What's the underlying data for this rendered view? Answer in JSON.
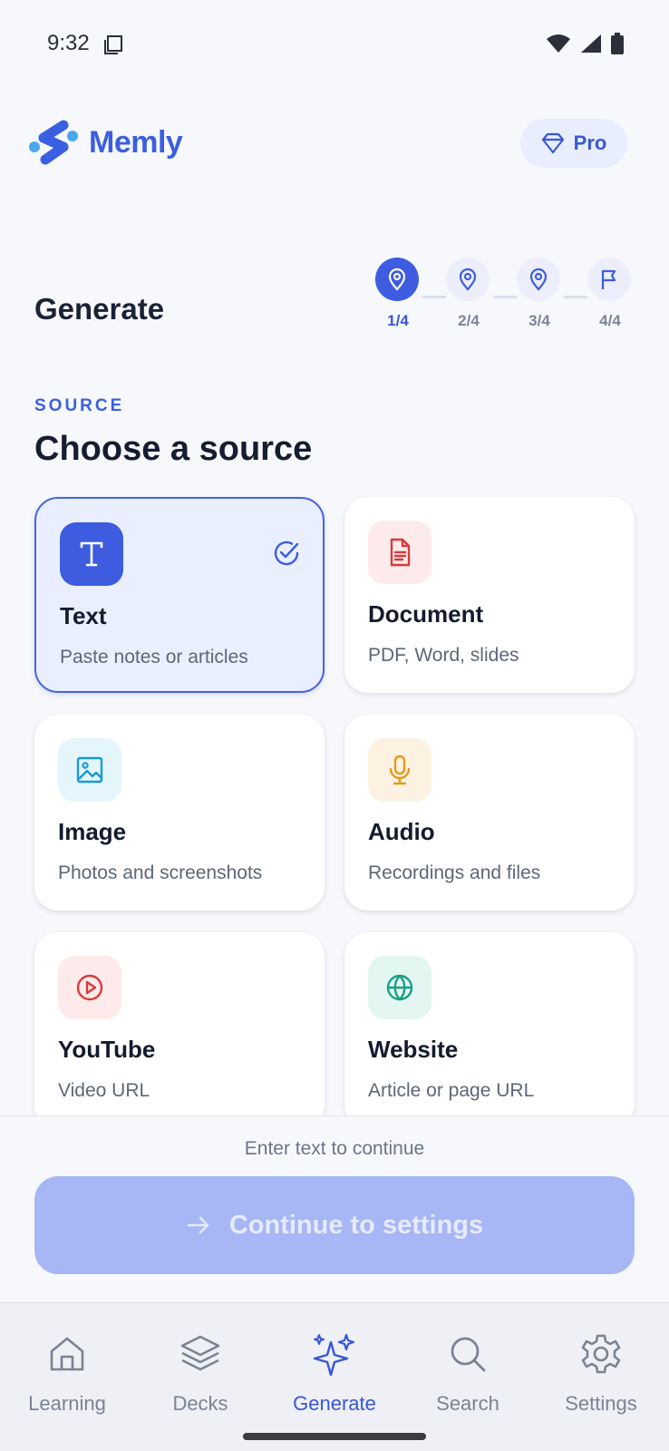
{
  "status_bar": {
    "time": "9:32"
  },
  "header": {
    "app_name": "Memly",
    "pro_label": "Pro"
  },
  "page": {
    "title": "Generate"
  },
  "stepper": {
    "steps": [
      {
        "label": "1/4",
        "icon": "location-pin-icon",
        "active": true
      },
      {
        "label": "2/4",
        "icon": "location-pin-icon",
        "active": false
      },
      {
        "label": "3/4",
        "icon": "location-pin-icon",
        "active": false
      },
      {
        "label": "4/4",
        "icon": "flag-icon",
        "active": false
      }
    ]
  },
  "section": {
    "eyebrow": "SOURCE",
    "title": "Choose a source"
  },
  "sources": [
    {
      "title": "Text",
      "subtitle": "Paste notes or articles",
      "icon": "text-t-icon",
      "selected": true
    },
    {
      "title": "Document",
      "subtitle": "PDF, Word, slides",
      "icon": "document-icon",
      "selected": false
    },
    {
      "title": "Image",
      "subtitle": "Photos and screenshots",
      "icon": "image-icon",
      "selected": false
    },
    {
      "title": "Audio",
      "subtitle": "Recordings and files",
      "icon": "microphone-icon",
      "selected": false
    },
    {
      "title": "YouTube",
      "subtitle": "Video URL",
      "icon": "play-circle-icon",
      "selected": false
    },
    {
      "title": "Website",
      "subtitle": "Article or page URL",
      "icon": "globe-icon",
      "selected": false
    }
  ],
  "footer": {
    "helper": "Enter text to continue",
    "continue_label": "Continue to settings"
  },
  "nav": {
    "items": [
      {
        "label": "Learning",
        "icon": "home-icon",
        "active": false
      },
      {
        "label": "Decks",
        "icon": "layers-icon",
        "active": false
      },
      {
        "label": "Generate",
        "icon": "sparkles-icon",
        "active": true
      },
      {
        "label": "Search",
        "icon": "search-icon",
        "active": false
      },
      {
        "label": "Settings",
        "icon": "gear-icon",
        "active": false
      }
    ]
  },
  "colors": {
    "accent": "#3d5ce0",
    "button_disabled": "#a7b7f5",
    "background": "#f7f8fc"
  }
}
